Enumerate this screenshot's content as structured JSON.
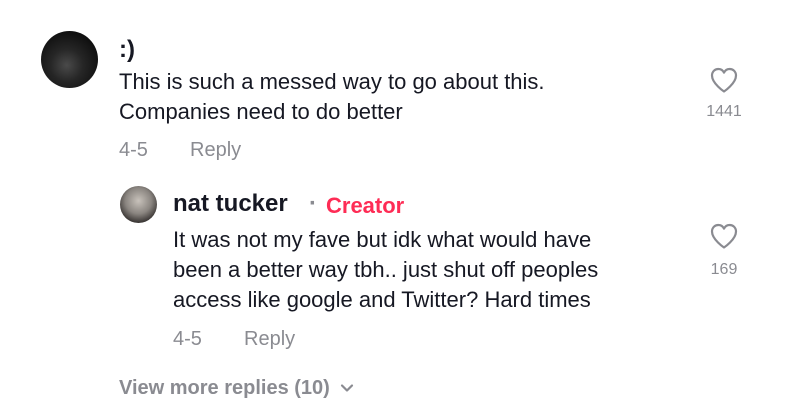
{
  "comments": [
    {
      "username": ":)",
      "text": "This is such a messed way to go about this.\nCompanies need to do better",
      "date": "4-5",
      "reply_label": "Reply",
      "likes": "1441"
    },
    {
      "username": "nat tucker",
      "separator": "·",
      "badge": "Creator",
      "text": "It was not my fave but idk what would have\nbeen a better way tbh.. just shut off peoples\naccess like google and Twitter? Hard times",
      "date": "4-5",
      "reply_label": "Reply",
      "likes": "169"
    }
  ],
  "view_more_label": "View more replies (10)",
  "icons": {
    "like": "heart-outline-icon",
    "expand": "chevron-down-icon"
  },
  "colors": {
    "creator_badge": "#fe2c55",
    "muted": "#8a8b91",
    "text": "#161823"
  }
}
